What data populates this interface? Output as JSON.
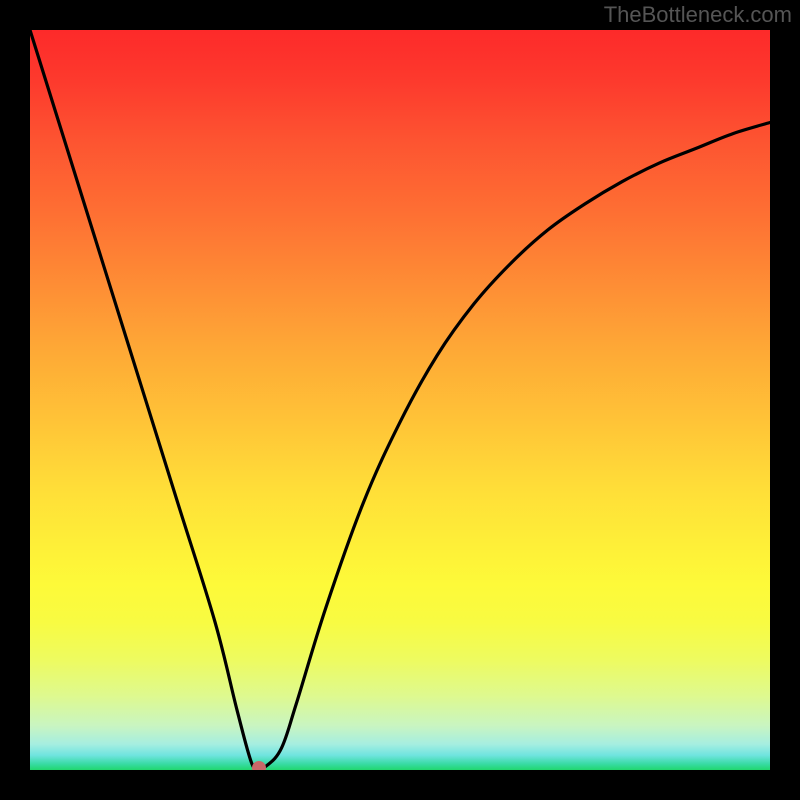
{
  "watermark": "TheBottleneck.com",
  "chart_data": {
    "type": "line",
    "title": "",
    "xlabel": "",
    "ylabel": "",
    "xlim": [
      0,
      100
    ],
    "ylim": [
      0,
      100
    ],
    "grid": false,
    "legend": false,
    "series": [
      {
        "name": "bottleneck-curve",
        "x": [
          0,
          5,
          10,
          15,
          20,
          25,
          28,
          30,
          31,
          32,
          34,
          36,
          40,
          45,
          50,
          55,
          60,
          65,
          70,
          75,
          80,
          85,
          90,
          95,
          100
        ],
        "values": [
          100,
          84,
          68,
          52,
          36,
          20,
          8,
          0.8,
          0.5,
          0.6,
          3,
          9,
          22,
          36,
          47,
          56,
          63,
          68.5,
          73,
          76.5,
          79.5,
          82,
          84,
          86,
          87.5
        ]
      }
    ],
    "annotations": [
      {
        "name": "optimal-point",
        "x": 31,
        "y": 0.3,
        "color": "#c86868"
      }
    ],
    "background_gradient": {
      "direction": "vertical",
      "stops": [
        {
          "pos": 0,
          "color": "#fd2a2a"
        },
        {
          "pos": 50,
          "color": "#ffc137"
        },
        {
          "pos": 80,
          "color": "#fdfa39"
        },
        {
          "pos": 100,
          "color": "#21d76e"
        }
      ]
    }
  }
}
